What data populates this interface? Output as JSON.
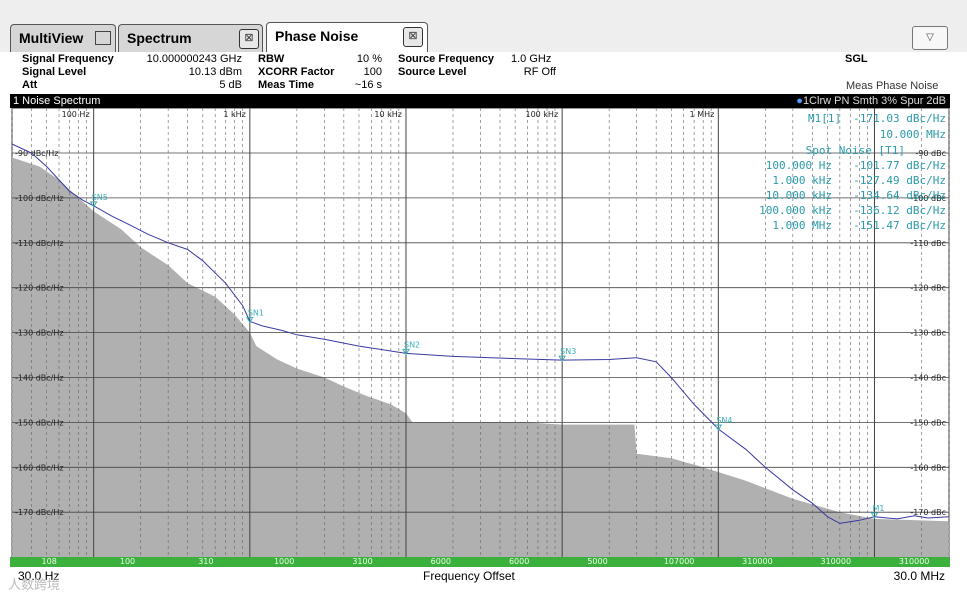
{
  "tabs": [
    {
      "label": "MultiView",
      "active": false
    },
    {
      "label": "Spectrum",
      "active": false
    },
    {
      "label": "Phase Noise",
      "active": true
    }
  ],
  "tab_close_glyph": "⊠",
  "dropdown_glyph": "▽",
  "settings": {
    "signal_frequency_label": "Signal Frequency",
    "signal_frequency_value": "10.000000243 GHz",
    "signal_level_label": "Signal Level",
    "signal_level_value": "10.13 dBm",
    "att_label": "Att",
    "att_value": "5 dB",
    "rbw_label": "RBW",
    "rbw_value": "10 %",
    "xcorr_label": "XCORR Factor",
    "xcorr_value": "100",
    "meas_time_label": "Meas Time",
    "meas_time_value": "~16 s",
    "source_frequency_label": "Source Frequency",
    "source_frequency_value": "1.0 GHz",
    "source_level_label": "Source Level",
    "source_level_value": "RF Off",
    "sgl": "SGL",
    "meas_mode": "Meas Phase Noise"
  },
  "window": {
    "title": "1 Noise Spectrum",
    "trace_info": "1Clrw PN Smth 3% Spur 2dB"
  },
  "x_ticks": [
    "100 Hz",
    "1 kHz",
    "10 kHz",
    "100 kHz",
    "1 MHz"
  ],
  "y_left_labels": [
    "-90 dBc/Hz",
    "-100 dBc/Hz",
    "-110 dBc/Hz",
    "-120 dBc/Hz",
    "-130 dBc/Hz",
    "-140 dBc/Hz",
    "-150 dBc/Hz",
    "-160 dBc/Hz",
    "-170 dBc/Hz"
  ],
  "y_right_labels": [
    "-90 dBc",
    "-100 dBc",
    "-110 dBc",
    "-120 dBc",
    "-130 dBc",
    "-140 dBc",
    "-150 dBc",
    "-160 dBc",
    "-170 dBc"
  ],
  "marker": {
    "label": "M1[1]",
    "value": "-171.03 dBc/Hz",
    "freq": "10.000 MHz"
  },
  "spot_noise": {
    "title": "Spot Noise [T1]",
    "rows": [
      {
        "freq": "100.000 Hz",
        "value": "-101.77 dBc/Hz"
      },
      {
        "freq": "1.000 kHz",
        "value": "-127.49 dBc/Hz"
      },
      {
        "freq": "10.000 kHz",
        "value": "-134.64 dBc/Hz"
      },
      {
        "freq": "100.000 kHz",
        "value": "-136.12 dBc/Hz"
      },
      {
        "freq": "1.000 MHz",
        "value": "-151.47 dBc/Hz"
      }
    ]
  },
  "trace_markers": [
    {
      "label": "SN5",
      "freq_hz": 100,
      "level": -101.77
    },
    {
      "label": "SN1",
      "freq_hz": 1000,
      "level": -127.49
    },
    {
      "label": "SN2",
      "freq_hz": 10000,
      "level": -134.64
    },
    {
      "label": "SN3",
      "freq_hz": 100000,
      "level": -136.12
    },
    {
      "label": "SN4",
      "freq_hz": 1000000,
      "level": -151.47
    },
    {
      "label": "M1",
      "freq_hz": 10000000,
      "level": -171.03
    }
  ],
  "xcorr_counts": [
    "108",
    "100",
    "310",
    "1000",
    "3100",
    "6000",
    "6000",
    "5000",
    "107000",
    "310000",
    "310000",
    "310000"
  ],
  "bottom": {
    "start": "30.0 Hz",
    "center": "Frequency Offset",
    "stop": "30.0 MHz"
  },
  "watermark": "人数跨境",
  "colors": {
    "trace": "#3a3aa0",
    "marker": "#3ab0b8",
    "table": "#2a9aaa",
    "status_bar": "#3cb03c",
    "shade": "#b0b0b0"
  }
}
